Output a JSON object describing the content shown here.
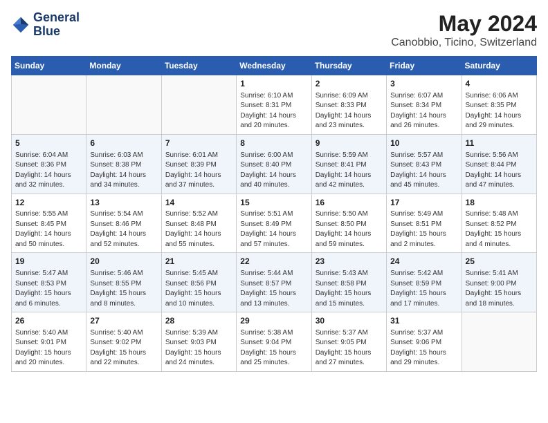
{
  "header": {
    "logo_line1": "General",
    "logo_line2": "Blue",
    "title": "May 2024",
    "subtitle": "Canobbio, Ticino, Switzerland"
  },
  "days_of_week": [
    "Sunday",
    "Monday",
    "Tuesday",
    "Wednesday",
    "Thursday",
    "Friday",
    "Saturday"
  ],
  "weeks": [
    [
      {
        "day": "",
        "content": ""
      },
      {
        "day": "",
        "content": ""
      },
      {
        "day": "",
        "content": ""
      },
      {
        "day": "1",
        "content": "Sunrise: 6:10 AM\nSunset: 8:31 PM\nDaylight: 14 hours\nand 20 minutes."
      },
      {
        "day": "2",
        "content": "Sunrise: 6:09 AM\nSunset: 8:33 PM\nDaylight: 14 hours\nand 23 minutes."
      },
      {
        "day": "3",
        "content": "Sunrise: 6:07 AM\nSunset: 8:34 PM\nDaylight: 14 hours\nand 26 minutes."
      },
      {
        "day": "4",
        "content": "Sunrise: 6:06 AM\nSunset: 8:35 PM\nDaylight: 14 hours\nand 29 minutes."
      }
    ],
    [
      {
        "day": "5",
        "content": "Sunrise: 6:04 AM\nSunset: 8:36 PM\nDaylight: 14 hours\nand 32 minutes."
      },
      {
        "day": "6",
        "content": "Sunrise: 6:03 AM\nSunset: 8:38 PM\nDaylight: 14 hours\nand 34 minutes."
      },
      {
        "day": "7",
        "content": "Sunrise: 6:01 AM\nSunset: 8:39 PM\nDaylight: 14 hours\nand 37 minutes."
      },
      {
        "day": "8",
        "content": "Sunrise: 6:00 AM\nSunset: 8:40 PM\nDaylight: 14 hours\nand 40 minutes."
      },
      {
        "day": "9",
        "content": "Sunrise: 5:59 AM\nSunset: 8:41 PM\nDaylight: 14 hours\nand 42 minutes."
      },
      {
        "day": "10",
        "content": "Sunrise: 5:57 AM\nSunset: 8:43 PM\nDaylight: 14 hours\nand 45 minutes."
      },
      {
        "day": "11",
        "content": "Sunrise: 5:56 AM\nSunset: 8:44 PM\nDaylight: 14 hours\nand 47 minutes."
      }
    ],
    [
      {
        "day": "12",
        "content": "Sunrise: 5:55 AM\nSunset: 8:45 PM\nDaylight: 14 hours\nand 50 minutes."
      },
      {
        "day": "13",
        "content": "Sunrise: 5:54 AM\nSunset: 8:46 PM\nDaylight: 14 hours\nand 52 minutes."
      },
      {
        "day": "14",
        "content": "Sunrise: 5:52 AM\nSunset: 8:48 PM\nDaylight: 14 hours\nand 55 minutes."
      },
      {
        "day": "15",
        "content": "Sunrise: 5:51 AM\nSunset: 8:49 PM\nDaylight: 14 hours\nand 57 minutes."
      },
      {
        "day": "16",
        "content": "Sunrise: 5:50 AM\nSunset: 8:50 PM\nDaylight: 14 hours\nand 59 minutes."
      },
      {
        "day": "17",
        "content": "Sunrise: 5:49 AM\nSunset: 8:51 PM\nDaylight: 15 hours\nand 2 minutes."
      },
      {
        "day": "18",
        "content": "Sunrise: 5:48 AM\nSunset: 8:52 PM\nDaylight: 15 hours\nand 4 minutes."
      }
    ],
    [
      {
        "day": "19",
        "content": "Sunrise: 5:47 AM\nSunset: 8:53 PM\nDaylight: 15 hours\nand 6 minutes."
      },
      {
        "day": "20",
        "content": "Sunrise: 5:46 AM\nSunset: 8:55 PM\nDaylight: 15 hours\nand 8 minutes."
      },
      {
        "day": "21",
        "content": "Sunrise: 5:45 AM\nSunset: 8:56 PM\nDaylight: 15 hours\nand 10 minutes."
      },
      {
        "day": "22",
        "content": "Sunrise: 5:44 AM\nSunset: 8:57 PM\nDaylight: 15 hours\nand 13 minutes."
      },
      {
        "day": "23",
        "content": "Sunrise: 5:43 AM\nSunset: 8:58 PM\nDaylight: 15 hours\nand 15 minutes."
      },
      {
        "day": "24",
        "content": "Sunrise: 5:42 AM\nSunset: 8:59 PM\nDaylight: 15 hours\nand 17 minutes."
      },
      {
        "day": "25",
        "content": "Sunrise: 5:41 AM\nSunset: 9:00 PM\nDaylight: 15 hours\nand 18 minutes."
      }
    ],
    [
      {
        "day": "26",
        "content": "Sunrise: 5:40 AM\nSunset: 9:01 PM\nDaylight: 15 hours\nand 20 minutes."
      },
      {
        "day": "27",
        "content": "Sunrise: 5:40 AM\nSunset: 9:02 PM\nDaylight: 15 hours\nand 22 minutes."
      },
      {
        "day": "28",
        "content": "Sunrise: 5:39 AM\nSunset: 9:03 PM\nDaylight: 15 hours\nand 24 minutes."
      },
      {
        "day": "29",
        "content": "Sunrise: 5:38 AM\nSunset: 9:04 PM\nDaylight: 15 hours\nand 25 minutes."
      },
      {
        "day": "30",
        "content": "Sunrise: 5:37 AM\nSunset: 9:05 PM\nDaylight: 15 hours\nand 27 minutes."
      },
      {
        "day": "31",
        "content": "Sunrise: 5:37 AM\nSunset: 9:06 PM\nDaylight: 15 hours\nand 29 minutes."
      },
      {
        "day": "",
        "content": ""
      }
    ]
  ]
}
